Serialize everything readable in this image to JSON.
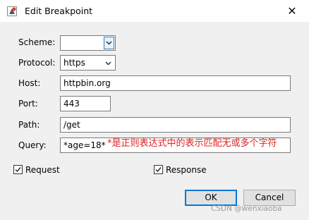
{
  "window": {
    "title": "Edit Breakpoint",
    "close_glyph": "✕",
    "icon": "breakpoint-app-icon"
  },
  "form": {
    "scheme": {
      "label": "Scheme:",
      "value": ""
    },
    "protocol": {
      "label": "Protocol:",
      "value": "https"
    },
    "host": {
      "label": "Host:",
      "value": "httpbin.org"
    },
    "port": {
      "label": "Port:",
      "value": "443"
    },
    "path": {
      "label": "Path:",
      "value": "/get"
    },
    "query": {
      "label": "Query:",
      "value": "*age=18*"
    }
  },
  "annotation": {
    "text": "*是正则表达式中的表示匹配无或多个字符",
    "color": "#e02020"
  },
  "options": {
    "request": {
      "label": "Request",
      "checked": true
    },
    "response": {
      "label": "Response",
      "checked": true
    }
  },
  "buttons": {
    "ok": "OK",
    "cancel": "Cancel"
  },
  "watermark": "CSDN @wenxiaoba",
  "colors": {
    "accent": "#0078d7",
    "dialog_bg": "#f0f0f0"
  }
}
